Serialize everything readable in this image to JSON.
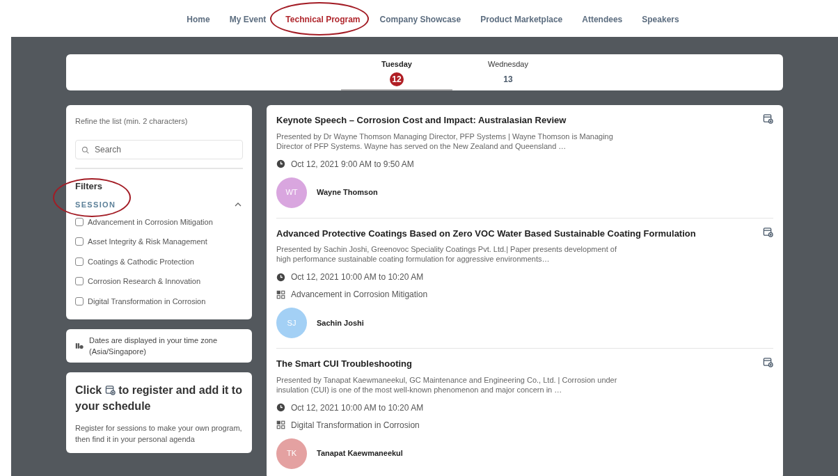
{
  "nav": [
    {
      "label": "Home",
      "selected": false
    },
    {
      "label": "My Event",
      "selected": false
    },
    {
      "label": "Technical Program",
      "selected": true
    },
    {
      "label": "Company Showcase",
      "selected": false
    },
    {
      "label": "Product Marketplace",
      "selected": false
    },
    {
      "label": "Attendees",
      "selected": false
    },
    {
      "label": "Speakers",
      "selected": false
    }
  ],
  "days": [
    {
      "weekday": "Tuesday",
      "date": "12",
      "selected": true
    },
    {
      "weekday": "Wednesday",
      "date": "13",
      "selected": false
    }
  ],
  "filter_panel": {
    "refine_label": "Refine the list (min. 2 characters)",
    "search": {
      "placeholder": "Search"
    },
    "filters_title": "Filters",
    "group": {
      "title": "SESSION",
      "expanded": true,
      "options": [
        {
          "label": "Advancement in Corrosion Mitigation",
          "checked": false
        },
        {
          "label": "Asset Integrity & Risk Management",
          "checked": false
        },
        {
          "label": "Coatings & Cathodic Protection",
          "checked": false
        },
        {
          "label": "Corrosion Research & Innovation",
          "checked": false
        },
        {
          "label": "Digital Transformation in Corrosion",
          "checked": false
        }
      ]
    }
  },
  "timezone_note": "Dates are displayed in your time zone (Asia/Singapore)",
  "register_card": {
    "title_before": "Click",
    "title_after": "to register and add it to your schedule",
    "body": "Register for sessions to make your own program, then find it in your personal agenda"
  },
  "sessions": [
    {
      "title": "Keynote Speech – Corrosion Cost and Impact: Australasian Review",
      "description": "Presented by Dr Wayne Thomson Managing Director, PFP Systems | Wayne Thomson is Managing Director of PFP Systems. Wayne has served on the New Zealand and Queensland …",
      "time": "Oct 12, 2021 9:00 AM to 9:50 AM",
      "speaker": {
        "initials": "WT",
        "name": "Wayne Thomson",
        "color": "#d9a6df"
      }
    },
    {
      "title": "Advanced Protective Coatings Based on Zero VOC Water Based Sustainable Coating Formulation",
      "description": "Presented by Sachin Joshi, Greenovoc Speciality Coatings Pvt. Ltd.| Paper presents development of high performance sustainable coating formulation for aggressive environments…",
      "time": "Oct 12, 2021 10:00 AM to 10:20 AM",
      "track": "Advancement in Corrosion Mitigation",
      "speaker": {
        "initials": "SJ",
        "name": "Sachin Joshi",
        "color": "#a3d0f5"
      }
    },
    {
      "title": "The Smart CUI Troubleshooting",
      "description": "Presented by Tanapat Kaewmaneekul, GC Maintenance and Engineering Co., Ltd. | Corrosion under insulation (CUI) is one of the most well-known phenomenon and major concern in …",
      "time": "Oct 12, 2021 10:00 AM to 10:20 AM",
      "track": "Digital Transformation in Corrosion",
      "speaker": {
        "initials": "TK",
        "name": "Tanapat Kaewmaneekul",
        "color": "#e4a1a1"
      }
    }
  ]
}
